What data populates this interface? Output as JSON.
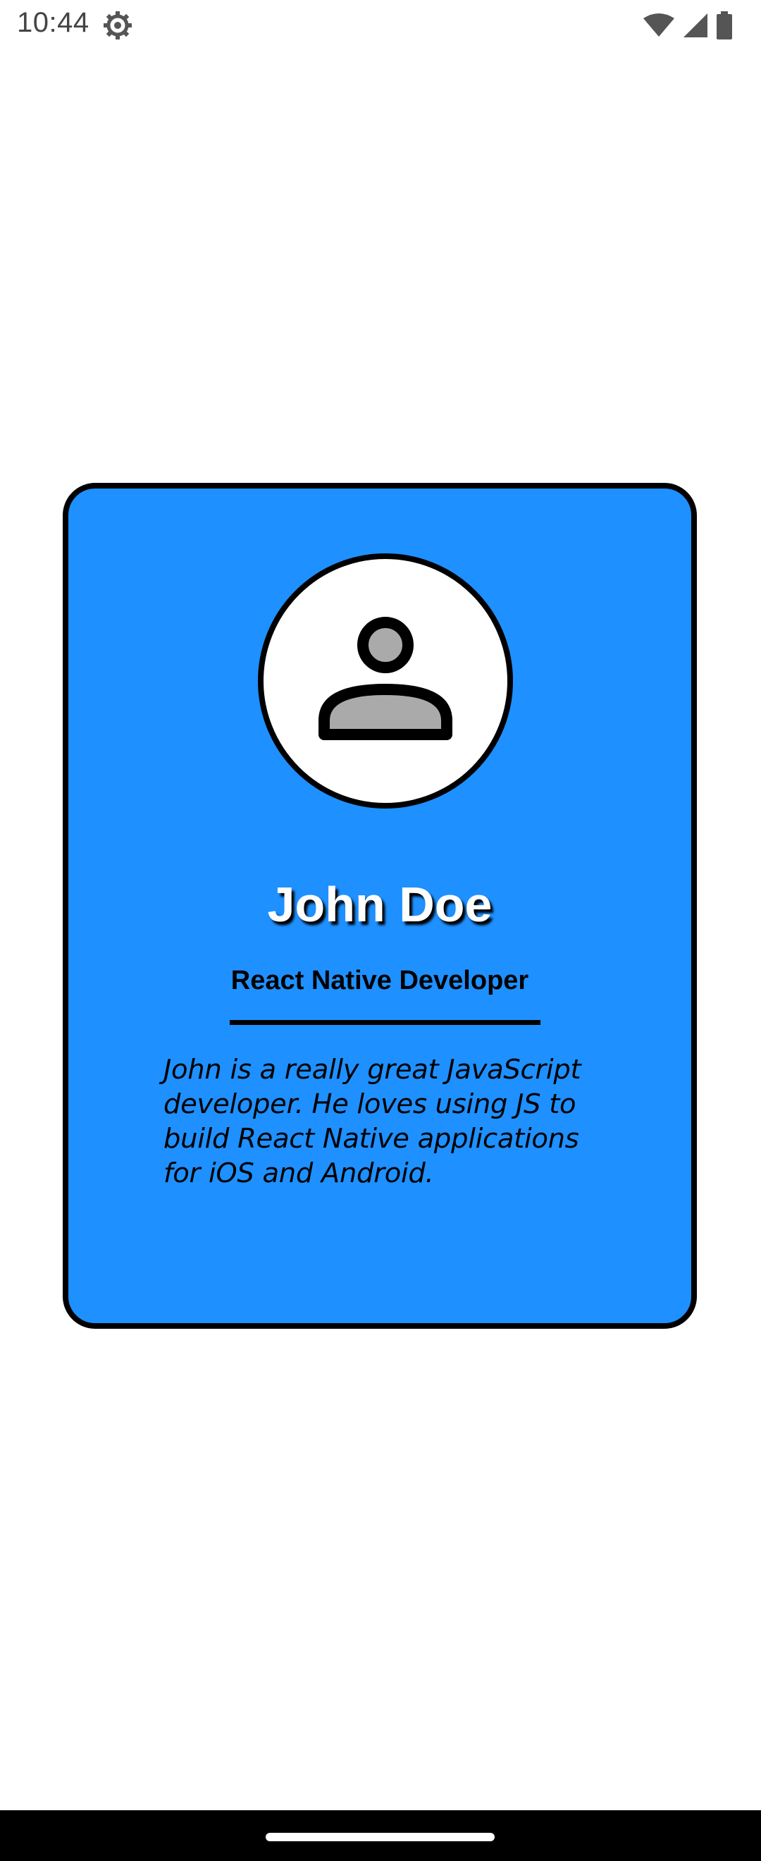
{
  "status_bar": {
    "time": "10:44",
    "icons": [
      "settings-gear-icon",
      "wifi-icon",
      "cellular-signal-icon",
      "battery-icon"
    ]
  },
  "profile": {
    "name": "John Doe",
    "role": "React Native Developer",
    "bio": "John is a really great JavaScript developer. He loves using JS to build React Native applications for iOS and Android.",
    "avatar_icon": "person-icon"
  },
  "colors": {
    "card_background": "#1e90ff",
    "card_border": "#000000",
    "name_text": "#ffffff",
    "avatar_background": "#ffffff",
    "avatar_figure": "#aaaaaa"
  }
}
